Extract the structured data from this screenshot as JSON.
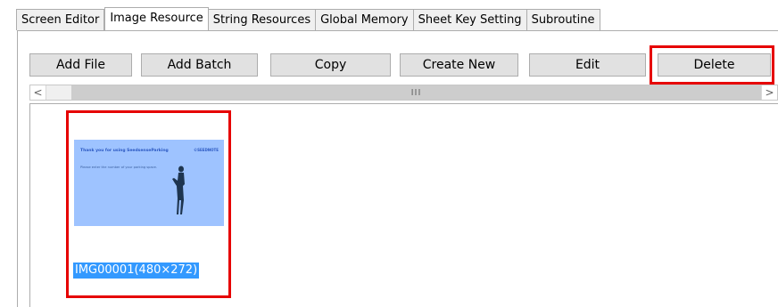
{
  "tabs": [
    "Screen Editor",
    "Image Resource",
    "String Resources",
    "Global Memory",
    "Sheet Key Setting",
    "Subroutine"
  ],
  "toolbar": {
    "add_file": "Add File",
    "add_batch": "Add Batch",
    "copy": "Copy",
    "create_new": "Create New",
    "edit": "Edit",
    "delete": "Delete"
  },
  "scrollbar": {
    "left_arrow": "<",
    "right_arrow": ">",
    "thumb_grip": "III"
  },
  "image_item": {
    "caption": "IMG00001(480×272)",
    "preview_title": "Thank you for using SeedsenseParking",
    "preview_subtitle": "Please enter the number of your parking space.",
    "preview_logo": "©SEEDNOTE"
  },
  "colors": {
    "highlight": "#e60000",
    "selection": "#3399ff",
    "preview_bg": "#9ec3ff"
  }
}
